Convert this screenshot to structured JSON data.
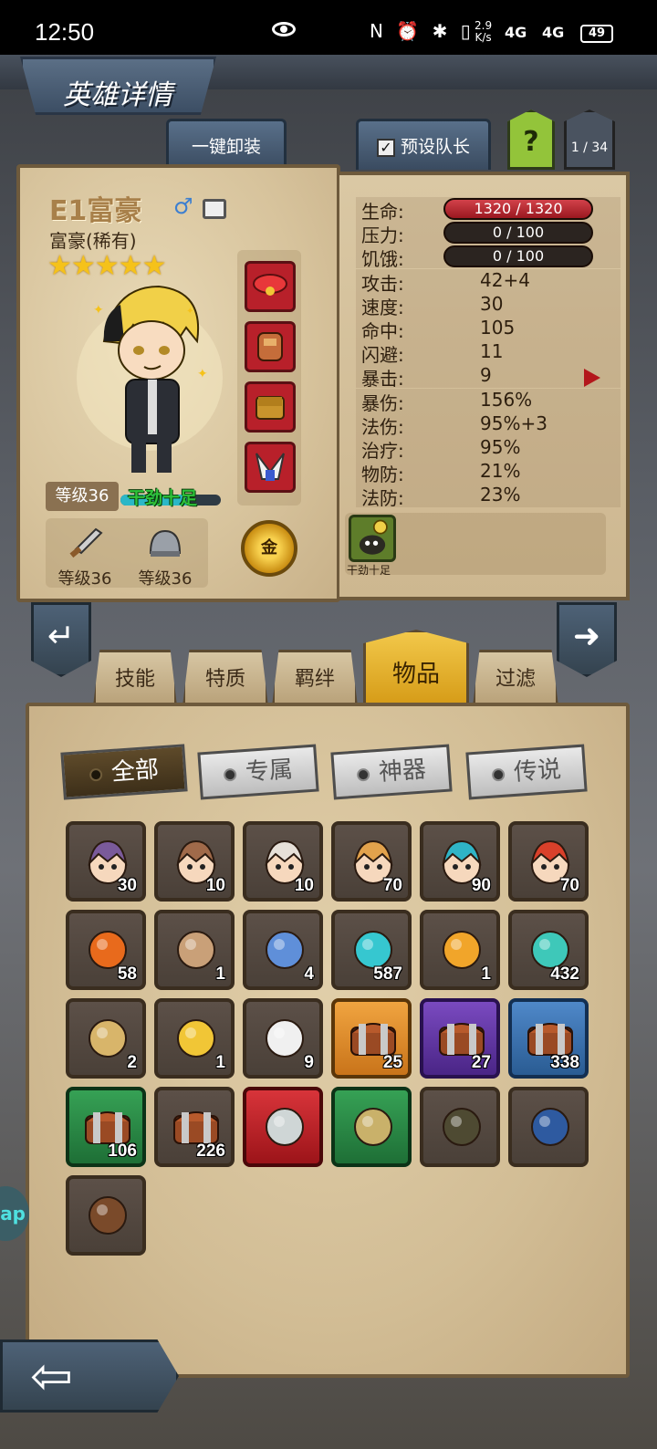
{
  "status_bar": {
    "time": "12:50",
    "icons_text": "N ⏰ ✱ ▯",
    "speed_value": "2.9",
    "speed_unit": "K/s",
    "signal_1": "4G",
    "signal_2": "4G",
    "battery": "49"
  },
  "header": {
    "title": "英雄详情",
    "unequip_all": "一键卸装",
    "preset_captain": "预设队长",
    "preset_captain_check": "✓",
    "help": "?",
    "page_counter": "1 / 34"
  },
  "hero": {
    "name": "E1富豪",
    "gender_symbol": "♂",
    "class": "富豪(稀有)",
    "stars": "★★★★★",
    "level": "等级36",
    "energy_status": "干劲十足",
    "energy_fraction": 0.7,
    "weapon_level": "等级36",
    "armor_level": "等级36",
    "gold_badge": "金"
  },
  "stats": [
    {
      "label": "生命:",
      "value": "1320 / 1320",
      "kind": "bar-hp"
    },
    {
      "label": "压力:",
      "value": "0 / 100",
      "kind": "bar"
    },
    {
      "label": "饥饿:",
      "value": "0 / 100",
      "kind": "bar"
    },
    {
      "label": "攻击:",
      "value": "42+4"
    },
    {
      "label": "速度:",
      "value": "30"
    },
    {
      "label": "命中:",
      "value": "105"
    },
    {
      "label": "闪避:",
      "value": "11"
    },
    {
      "label": "暴击:",
      "value": "9"
    },
    {
      "label": "暴伤:",
      "value": "156%"
    },
    {
      "label": "法伤:",
      "value": "95%+3"
    },
    {
      "label": "治疗:",
      "value": "95%"
    },
    {
      "label": "物防:",
      "value": "21%"
    },
    {
      "label": "法防:",
      "value": "23%"
    }
  ],
  "trait": {
    "label": "干劲十足"
  },
  "tabs": {
    "skills": "技能",
    "traits": "特质",
    "bonds": "羁绊",
    "items": "物品",
    "filter": "过滤"
  },
  "filters": {
    "all": "全部",
    "exclusive": "专属",
    "artifact": "神器",
    "legendary": "传说"
  },
  "inventory": [
    {
      "name": "hero-shard-1",
      "qty": "30",
      "color": "gray",
      "tint": "#7a5a9a"
    },
    {
      "name": "hero-shard-2",
      "qty": "10",
      "color": "gray",
      "tint": "#a06a4a"
    },
    {
      "name": "hero-shard-3",
      "qty": "10",
      "color": "gray",
      "tint": "#e6e0d8"
    },
    {
      "name": "hero-shard-4",
      "qty": "70",
      "color": "gray",
      "tint": "#e2a24c"
    },
    {
      "name": "hero-shard-5",
      "qty": "90",
      "color": "gray",
      "tint": "#2fb4c6"
    },
    {
      "name": "hero-shard-6",
      "qty": "70",
      "color": "gray",
      "tint": "#d9402a"
    },
    {
      "name": "fire-gem",
      "qty": "58",
      "color": "gray",
      "tint": "#e86a1c"
    },
    {
      "name": "knife",
      "qty": "1",
      "color": "gray",
      "tint": "#c9a078"
    },
    {
      "name": "blue-sand",
      "qty": "4",
      "color": "gray",
      "tint": "#5f8fd9"
    },
    {
      "name": "rune-stone",
      "qty": "587",
      "color": "gray",
      "tint": "#36c7d0"
    },
    {
      "name": "golden-feather",
      "qty": "1",
      "color": "gray",
      "tint": "#f1a52a"
    },
    {
      "name": "potion",
      "qty": "432",
      "color": "gray",
      "tint": "#3ec8b9"
    },
    {
      "name": "scroll-badge",
      "qty": "2",
      "color": "gray",
      "tint": "#d8b56a"
    },
    {
      "name": "golden-ticket",
      "qty": "1",
      "color": "gray",
      "tint": "#f1c636"
    },
    {
      "name": "white-feather",
      "qty": "9",
      "color": "gray",
      "tint": "#f0f0f0"
    },
    {
      "name": "chest-orange",
      "qty": "25",
      "color": "orange",
      "tint": "#c9c9c9"
    },
    {
      "name": "chest-purple",
      "qty": "27",
      "color": "purple",
      "tint": "#c9c9c9"
    },
    {
      "name": "chest-blue",
      "qty": "338",
      "color": "blue",
      "tint": "#c9c9c9"
    },
    {
      "name": "chest-green",
      "qty": "106",
      "color": "green",
      "tint": "#c9c9c9"
    },
    {
      "name": "chest-gray",
      "qty": "226",
      "color": "gray",
      "tint": "#c9c9c9"
    },
    {
      "name": "trident",
      "qty": "",
      "color": "red",
      "tint": "#cfd6d6"
    },
    {
      "name": "jade-ring",
      "qty": "",
      "color": "green",
      "tint": "#c9b16a"
    },
    {
      "name": "backpack",
      "qty": "",
      "color": "gray",
      "tint": "#4e4a32"
    },
    {
      "name": "spellbook",
      "qty": "",
      "color": "gray",
      "tint": "#2e5aa0"
    },
    {
      "name": "wooden-shield",
      "qty": "",
      "color": "gray",
      "tint": "#7a4a2a"
    }
  ],
  "side_tab": "ap",
  "back_arrow": "⇦"
}
